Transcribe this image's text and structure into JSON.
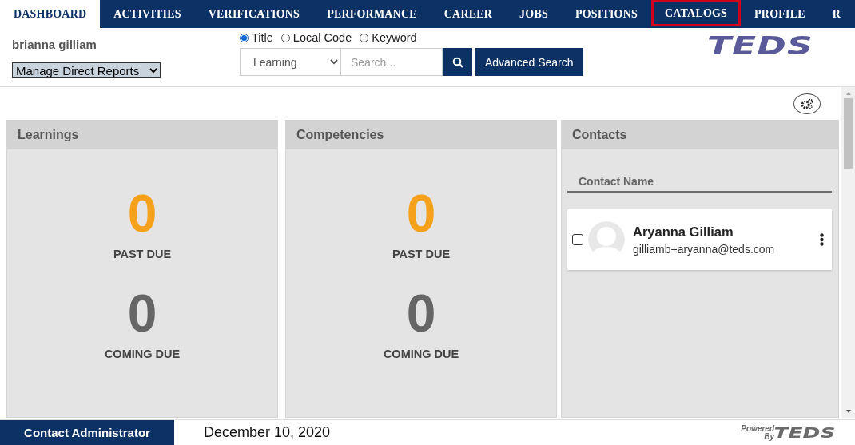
{
  "nav": {
    "tabs": [
      {
        "label": "DASHBOARD",
        "selected": true,
        "highlighted": false
      },
      {
        "label": "ACTIVITIES",
        "selected": false,
        "highlighted": false
      },
      {
        "label": "VERIFICATIONS",
        "selected": false,
        "highlighted": false
      },
      {
        "label": "PERFORMANCE",
        "selected": false,
        "highlighted": false
      },
      {
        "label": "CAREER",
        "selected": false,
        "highlighted": false
      },
      {
        "label": "JOBS",
        "selected": false,
        "highlighted": false
      },
      {
        "label": "POSITIONS",
        "selected": false,
        "highlighted": false
      },
      {
        "label": "CATALOGS",
        "selected": false,
        "highlighted": true
      },
      {
        "label": "PROFILE",
        "selected": false,
        "highlighted": false
      },
      {
        "label": "R",
        "selected": false,
        "highlighted": false
      }
    ]
  },
  "user": {
    "name": "brianna gilliam",
    "reports_dropdown": "Manage Direct Reports"
  },
  "search": {
    "modes": [
      {
        "label": "Title",
        "selected": true
      },
      {
        "label": "Local Code",
        "selected": false
      },
      {
        "label": "Keyword",
        "selected": false
      }
    ],
    "category": "Learning",
    "placeholder": "Search...",
    "advanced_button": "Advanced Search"
  },
  "logo": {
    "text": "TEDS"
  },
  "panels": [
    {
      "title": "Learnings",
      "stats": [
        {
          "kind": "past_due",
          "value": "0",
          "label": "PAST DUE"
        },
        {
          "kind": "coming_due",
          "value": "0",
          "label": "COMING DUE"
        }
      ]
    },
    {
      "title": "Competencies",
      "stats": [
        {
          "kind": "past_due",
          "value": "0",
          "label": "PAST DUE"
        },
        {
          "kind": "coming_due",
          "value": "0",
          "label": "COMING DUE"
        }
      ]
    }
  ],
  "contacts": {
    "title": "Contacts",
    "column": "Contact Name",
    "items": [
      {
        "name": "Aryanna Gilliam",
        "email": "gilliamb+aryanna@teds.com",
        "checked": false
      }
    ]
  },
  "footer": {
    "contact_button": "Contact Administrator",
    "date": "December 10, 2020",
    "powered": "Powered",
    "by": "By",
    "brand": "TEDS"
  }
}
